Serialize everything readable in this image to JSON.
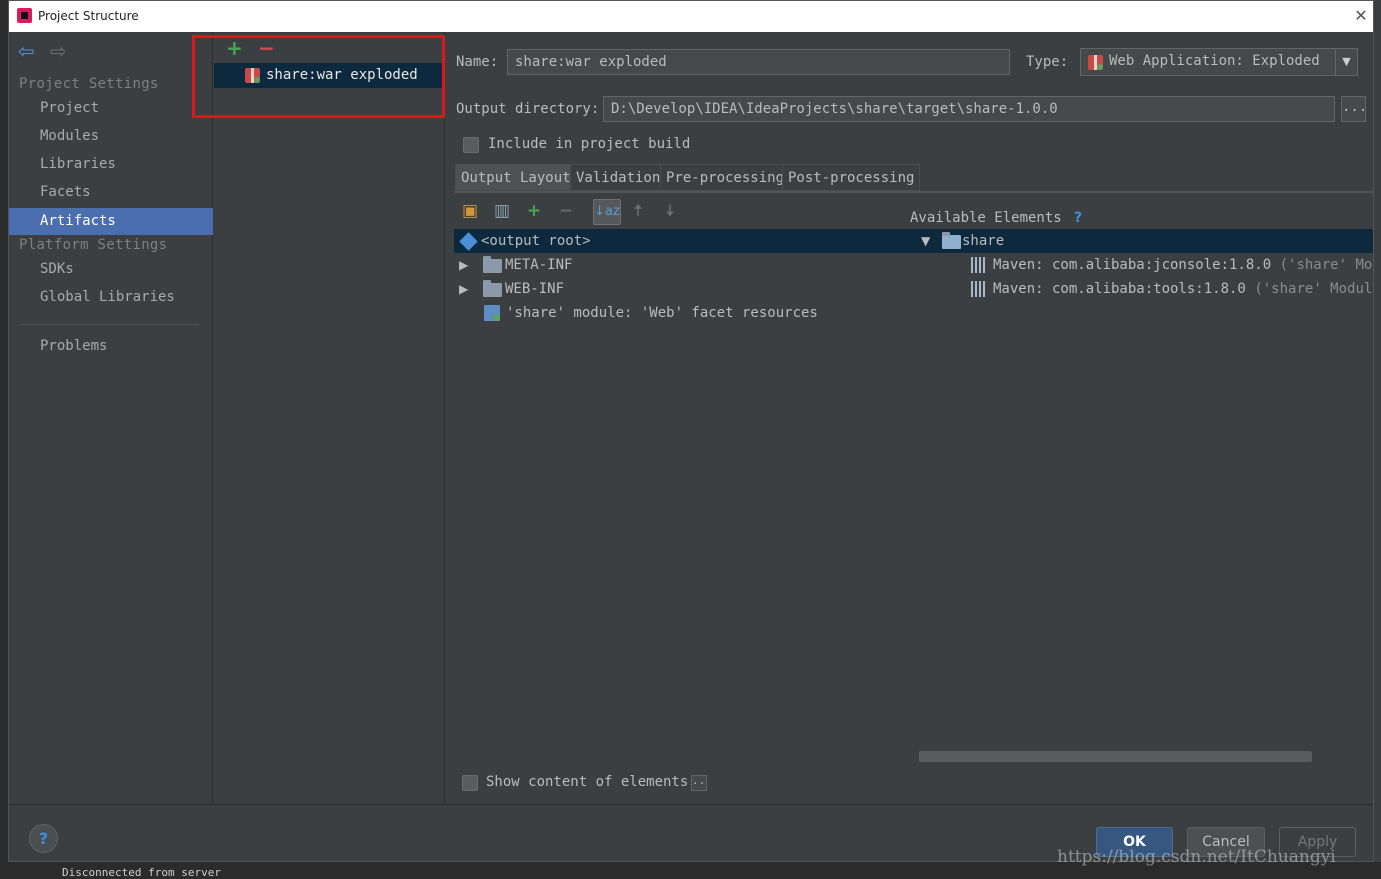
{
  "window": {
    "title": "Project Structure",
    "close_glyph": "✕"
  },
  "background": {
    "status_text": "Disconnected from server"
  },
  "nav": {
    "back_glyph": "⇦",
    "forward_glyph": "⇨",
    "project_settings_header": "Project Settings",
    "project_items": [
      "Project",
      "Modules",
      "Libraries",
      "Facets",
      "Artifacts"
    ],
    "selected_item": "Artifacts",
    "platform_settings_header": "Platform Settings",
    "platform_items": [
      "SDKs",
      "Global Libraries"
    ],
    "problems": "Problems"
  },
  "artifacts": {
    "add_glyph": "+",
    "remove_glyph": "−",
    "items": [
      "share:war exploded"
    ],
    "highlight_color": "#e0161d"
  },
  "form": {
    "name_label": "Name:",
    "name_value": "share:war exploded",
    "type_label": "Type:",
    "type_value": "Web Application: Exploded",
    "output_dir_label": "Output directory:",
    "output_dir_value": "D:\\Develop\\IDEA\\IdeaProjects\\share\\target\\share-1.0.0",
    "browse_glyph": "...",
    "include_build_label": "Include in project build",
    "include_build_checked": false
  },
  "tabs": [
    {
      "label": "Output Layout",
      "active": true
    },
    {
      "label": "Validation",
      "active": false
    },
    {
      "label": "Pre-processing",
      "active": false
    },
    {
      "label": "Post-processing",
      "active": false
    }
  ],
  "layout_tree": {
    "root": "<output root>",
    "children": [
      {
        "label": "META-INF",
        "type": "folder"
      },
      {
        "label": "WEB-INF",
        "type": "folder"
      },
      {
        "label": "'share' module: 'Web' facet resources",
        "type": "module"
      }
    ]
  },
  "available": {
    "label": "Available Elements",
    "help_glyph": "?",
    "root": "share",
    "items": [
      {
        "name": "Maven: com.alibaba:jconsole:1.8.0",
        "suffix": "('share' Module"
      },
      {
        "name": "Maven: com.alibaba:tools:1.8.0",
        "suffix": "('share' Module Li"
      }
    ]
  },
  "show_content": {
    "label": "Show content of elements",
    "more_glyph": "..."
  },
  "footer": {
    "help_glyph": "?",
    "ok": "OK",
    "cancel": "Cancel",
    "apply": "Apply"
  },
  "watermark": "https://blog.csdn.net/ItChuangyi",
  "colors": {
    "accent": "#4b6eaf",
    "selection": "#0d293e",
    "ok_button": "#365880",
    "add_green": "#48a84d",
    "remove_red": "#d05050"
  }
}
